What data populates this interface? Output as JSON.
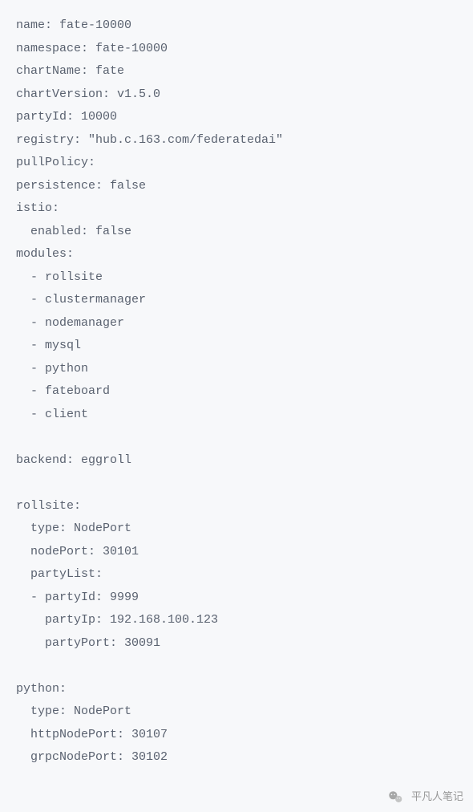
{
  "code": {
    "lines": [
      "name: fate-10000",
      "namespace: fate-10000",
      "chartName: fate",
      "chartVersion: v1.5.0",
      "partyId: 10000",
      "registry: \"hub.c.163.com/federatedai\"",
      "pullPolicy:",
      "persistence: false",
      "istio:",
      "  enabled: false",
      "modules:",
      "  - rollsite",
      "  - clustermanager",
      "  - nodemanager",
      "  - mysql",
      "  - python",
      "  - fateboard",
      "  - client",
      "",
      "backend: eggroll",
      "",
      "rollsite:",
      "  type: NodePort",
      "  nodePort: 30101",
      "  partyList:",
      "  - partyId: 9999",
      "    partyIp: 192.168.100.123",
      "    partyPort: 30091",
      "",
      "python:",
      "  type: NodePort",
      "  httpNodePort: 30107",
      "  grpcNodePort: 30102"
    ]
  },
  "watermark": {
    "text": "平凡人笔记"
  }
}
